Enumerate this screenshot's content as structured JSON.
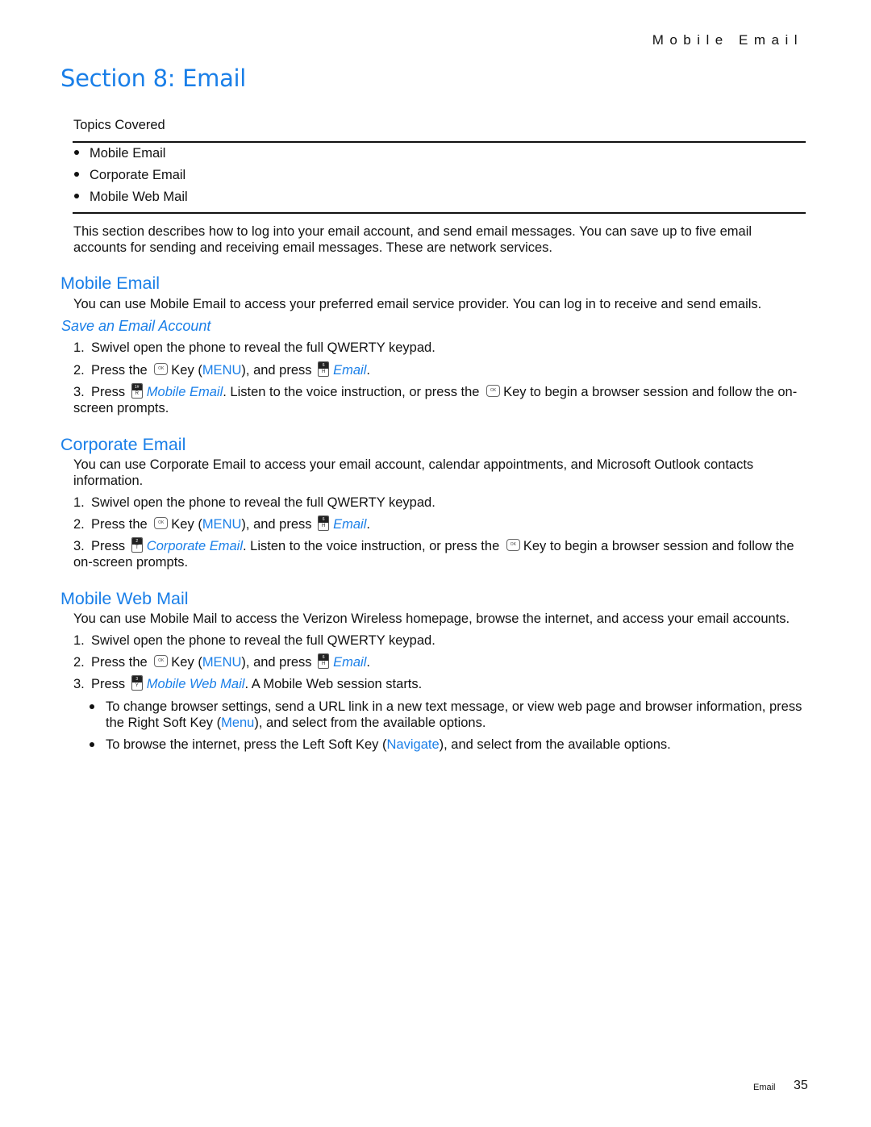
{
  "running_head": "Mobile Email",
  "section_title": "Section 8:  Email",
  "topics": {
    "label": "Topics Covered",
    "items": [
      "Mobile Email",
      "Corporate Email",
      "Mobile Web Mail"
    ]
  },
  "intro": "This section describes how to log into your email account, and send email messages. You can save up to five email accounts for sending and receiving email messages. These are network services.",
  "mobile_email": {
    "heading": "Mobile Email",
    "body": "You can use Mobile Email to access your preferred email service provider. You can log in to receive and send emails.",
    "subheading": "Save an Email Account",
    "step1": "Swivel open the phone to reveal the full QWERTY keypad.",
    "step2": {
      "pre": "Press the",
      "mid": "Key (",
      "menu": "MENU",
      "post": "), and press",
      "target": "Email",
      "end": "."
    },
    "step3": {
      "pre": "Press",
      "target": "Mobile Email",
      "mid": ". Listen to the voice instruction, or press the",
      "post": "Key to begin a browser session and follow the on-screen prompts."
    }
  },
  "corporate_email": {
    "heading": "Corporate Email",
    "body": "You can use Corporate Email to access your email account, calendar appointments, and Microsoft Outlook contacts information.",
    "step1": "Swivel open the phone to reveal the full QWERTY keypad.",
    "step2": {
      "pre": "Press the",
      "mid": "Key (",
      "menu": "MENU",
      "post": "), and press",
      "target": "Email",
      "end": "."
    },
    "step3": {
      "pre": "Press",
      "target": "Corporate Email",
      "mid": ". Listen to the voice instruction, or press the",
      "post": "Key to begin a browser session and follow the on-screen prompts."
    }
  },
  "mobile_web_mail": {
    "heading": "Mobile Web Mail",
    "body": "You can use Mobile Mail to access the Verizon Wireless homepage, browse the internet, and access your email accounts.",
    "step1": "Swivel open the phone to reveal the full QWERTY keypad.",
    "step2": {
      "pre": "Press the",
      "mid": "Key (",
      "menu": "MENU",
      "post": "), and press",
      "target": "Email",
      "end": "."
    },
    "step3": {
      "pre": "Press",
      "target": "Mobile Web Mail",
      "post": ". A Mobile Web session starts."
    },
    "bullet1": {
      "pre": "To change browser settings, send a URL link in a new text message, or view web page and browser information, press the Right Soft Key (",
      "key": "Menu",
      "post": "), and select from the available options."
    },
    "bullet2": {
      "pre": "To browse the internet, press the Left Soft Key (",
      "key": "Navigate",
      "post": "), and select from the available options."
    }
  },
  "keys": {
    "ok": {
      "icon": "ok-key-icon",
      "glyph": "OK"
    },
    "email": {
      "icon": "key-6-h-icon",
      "top": "6",
      "bottom": "H"
    },
    "mobile_email": {
      "icon": "key-r-icon",
      "top": "1#",
      "bottom": "R"
    },
    "corporate_email": {
      "icon": "key-2-t-icon",
      "top": "2",
      "bottom": "T"
    },
    "mobile_web_mail": {
      "icon": "key-3-y-icon",
      "top": "3",
      "bottom": "Y"
    }
  },
  "footer": {
    "label": "Email",
    "page": "35"
  },
  "colors": {
    "accent": "#1a7fe8",
    "text": "#111111"
  }
}
